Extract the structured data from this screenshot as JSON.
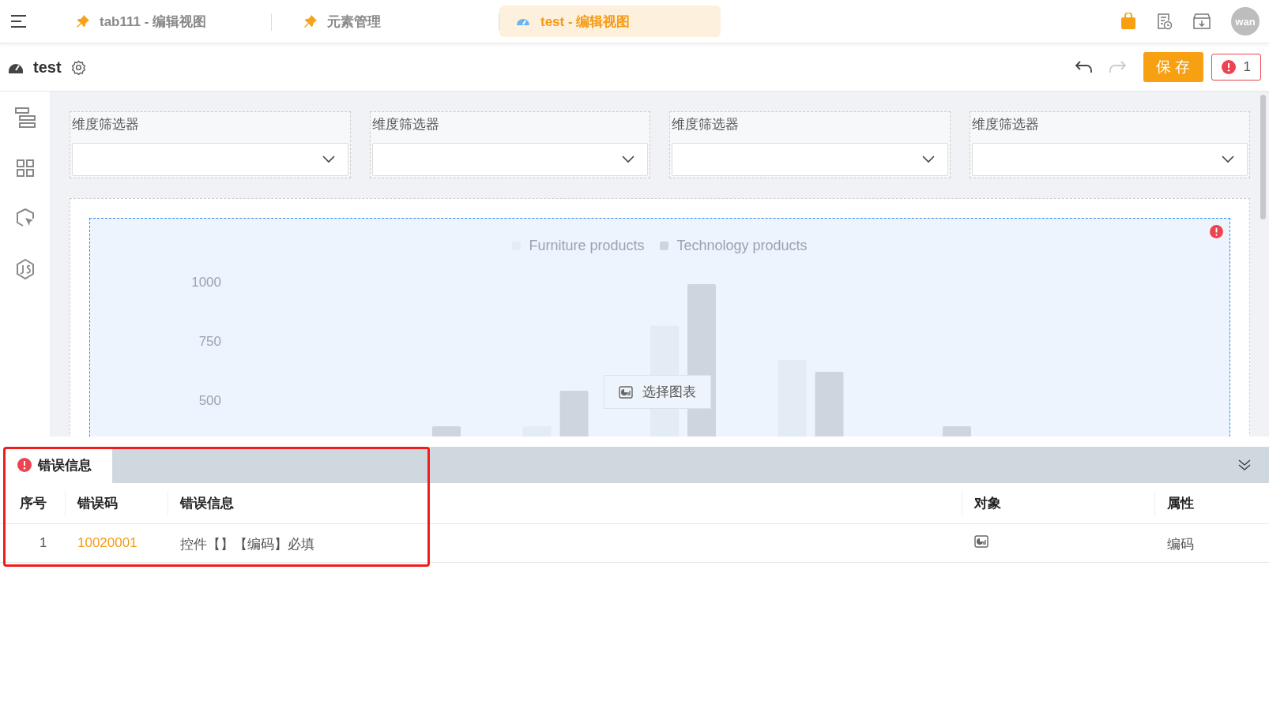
{
  "tabs": [
    {
      "label": "tab111 - 编辑视图",
      "kind": "pin",
      "selected": false
    },
    {
      "label": "元素管理",
      "kind": "pin",
      "selected": false
    },
    {
      "label": "test - 编辑视图",
      "kind": "dashboard",
      "selected": true
    }
  ],
  "avatar": "wan",
  "header": {
    "title": "test",
    "save": "保存",
    "error_count": "1"
  },
  "filters": [
    {
      "label": "维度筛选器"
    },
    {
      "label": "维度筛选器"
    },
    {
      "label": "维度筛选器"
    },
    {
      "label": "维度筛选器"
    }
  ],
  "chart": {
    "select_button": "选择图表",
    "legend": [
      {
        "name": "Furniture products",
        "color": "#e3ebf5"
      },
      {
        "name": "Technology products",
        "color": "#ced5de"
      }
    ],
    "axis_labels": [
      "1000",
      "750",
      "500"
    ]
  },
  "error_panel": {
    "tab": "错误信息",
    "columns": [
      "序号",
      "错误码",
      "错误信息",
      "对象",
      "属性"
    ],
    "rows": [
      {
        "index": "1",
        "code": "10020001",
        "message": "控件【】【编码】必填",
        "property": "编码"
      }
    ]
  }
}
